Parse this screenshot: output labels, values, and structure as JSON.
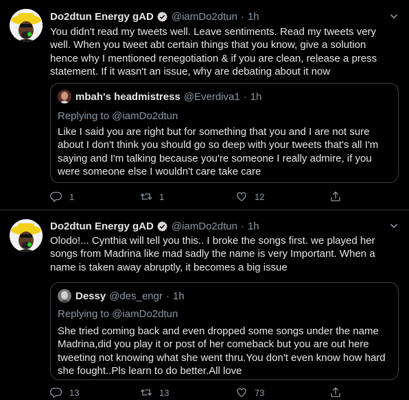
{
  "tweets": [
    {
      "name": "Do2dtun Energy gAD",
      "handle": "@iamDo2dtun",
      "dot": "·",
      "time": "1h",
      "text": "You didn't read my tweets well. Leave sentiments. Read my tweets very well. When you tweet abt certain things that you know, give a solution hence why I mentioned renegotiation & if you are clean, release a press statement. If it wasn't an issue, why are debating about it now",
      "quote": {
        "name": "mbah's headmistress",
        "handle": "@Everdiva1",
        "dot": "·",
        "time": "1h",
        "replying_prefix": "Replying to",
        "replying_to": "@iamDo2dtun",
        "text": "Like I said you are right but for something that you and I are not sure about I don't think you should go so deep with your tweets that's all I'm saying and I'm talking because you're someone I really admire, if you were someone else I wouldn't care take care"
      },
      "replies": "1",
      "retweets": "1",
      "likes": "12"
    },
    {
      "name": "Do2dtun Energy gAD",
      "handle": "@iamDo2dtun",
      "dot": "·",
      "time": "1h",
      "text": "Olodo!... Cynthia will tell you this.. I broke the songs first. we played her songs from Madrina like mad sadly the name is very Important. When a name is taken away abruptly, it becomes a big issue",
      "quote": {
        "name": "Dessy",
        "handle": "@des_engr",
        "dot": "·",
        "time": "1h",
        "replying_prefix": "Replying to",
        "replying_to": "@iamDo2dtun",
        "text": "She tried coming back and even dropped some songs under the name Madrina,did you play it or post of her comeback but you are out here tweeting not knowing what she went thru.You don't even know how hard she fought..Pls learn to do better.All love"
      },
      "replies": "13",
      "retweets": "13",
      "likes": "73"
    }
  ],
  "icons": {
    "verified": "verified-badge-icon",
    "caret": "chevron-down-icon",
    "reply": "reply-icon",
    "retweet": "retweet-icon",
    "like": "heart-icon",
    "share": "share-icon"
  },
  "colors": {
    "background": "#000000",
    "text": "#e7e9ea",
    "muted": "#8b98a5",
    "border": "#3d4247",
    "verified": "#d9d9d9"
  }
}
